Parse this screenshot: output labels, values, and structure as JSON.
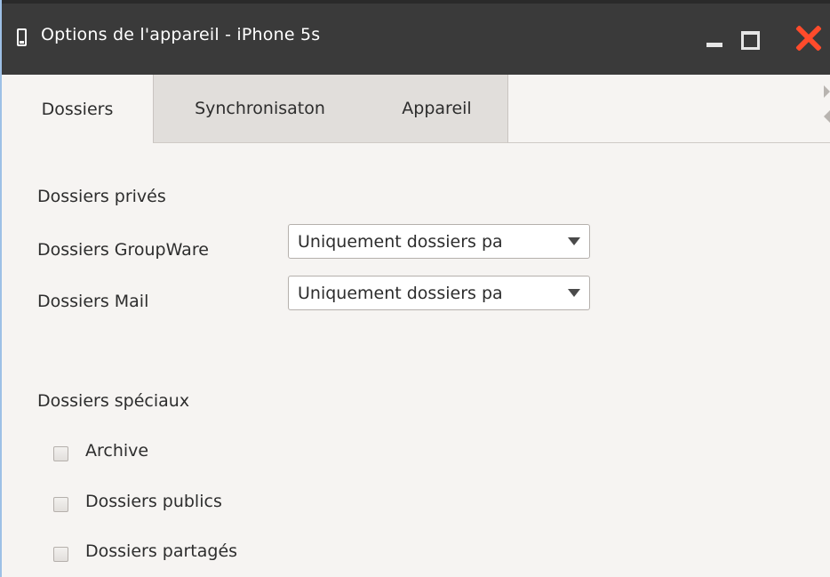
{
  "window": {
    "title": "Options de l'appareil - iPhone 5s",
    "icon": "phone-icon",
    "controls": [
      "minimize-icon",
      "maximize-icon",
      "close-icon"
    ]
  },
  "tabs": [
    {
      "label": "Dossiers",
      "active": true
    },
    {
      "label": "Synchronisaton",
      "active": false
    },
    {
      "label": "Appareil",
      "active": false
    }
  ],
  "private_folders": {
    "heading": "Dossiers privés",
    "fields": [
      {
        "label": "Dossiers GroupWare",
        "value": "Uniquement dossiers pa"
      },
      {
        "label": "Dossiers Mail",
        "value": "Uniquement dossiers pa"
      }
    ]
  },
  "special_folders": {
    "heading": "Dossiers spéciaux",
    "options": [
      {
        "label": "Archive",
        "checked": false
      },
      {
        "label": "Dossiers publics",
        "checked": false
      },
      {
        "label": "Dossiers partagés",
        "checked": false
      }
    ]
  },
  "colors": {
    "titlebar": "#3a3a3a",
    "background": "#f6f4f2",
    "close": "#ff4b2b",
    "inactive_tab": "#e1dedb"
  }
}
